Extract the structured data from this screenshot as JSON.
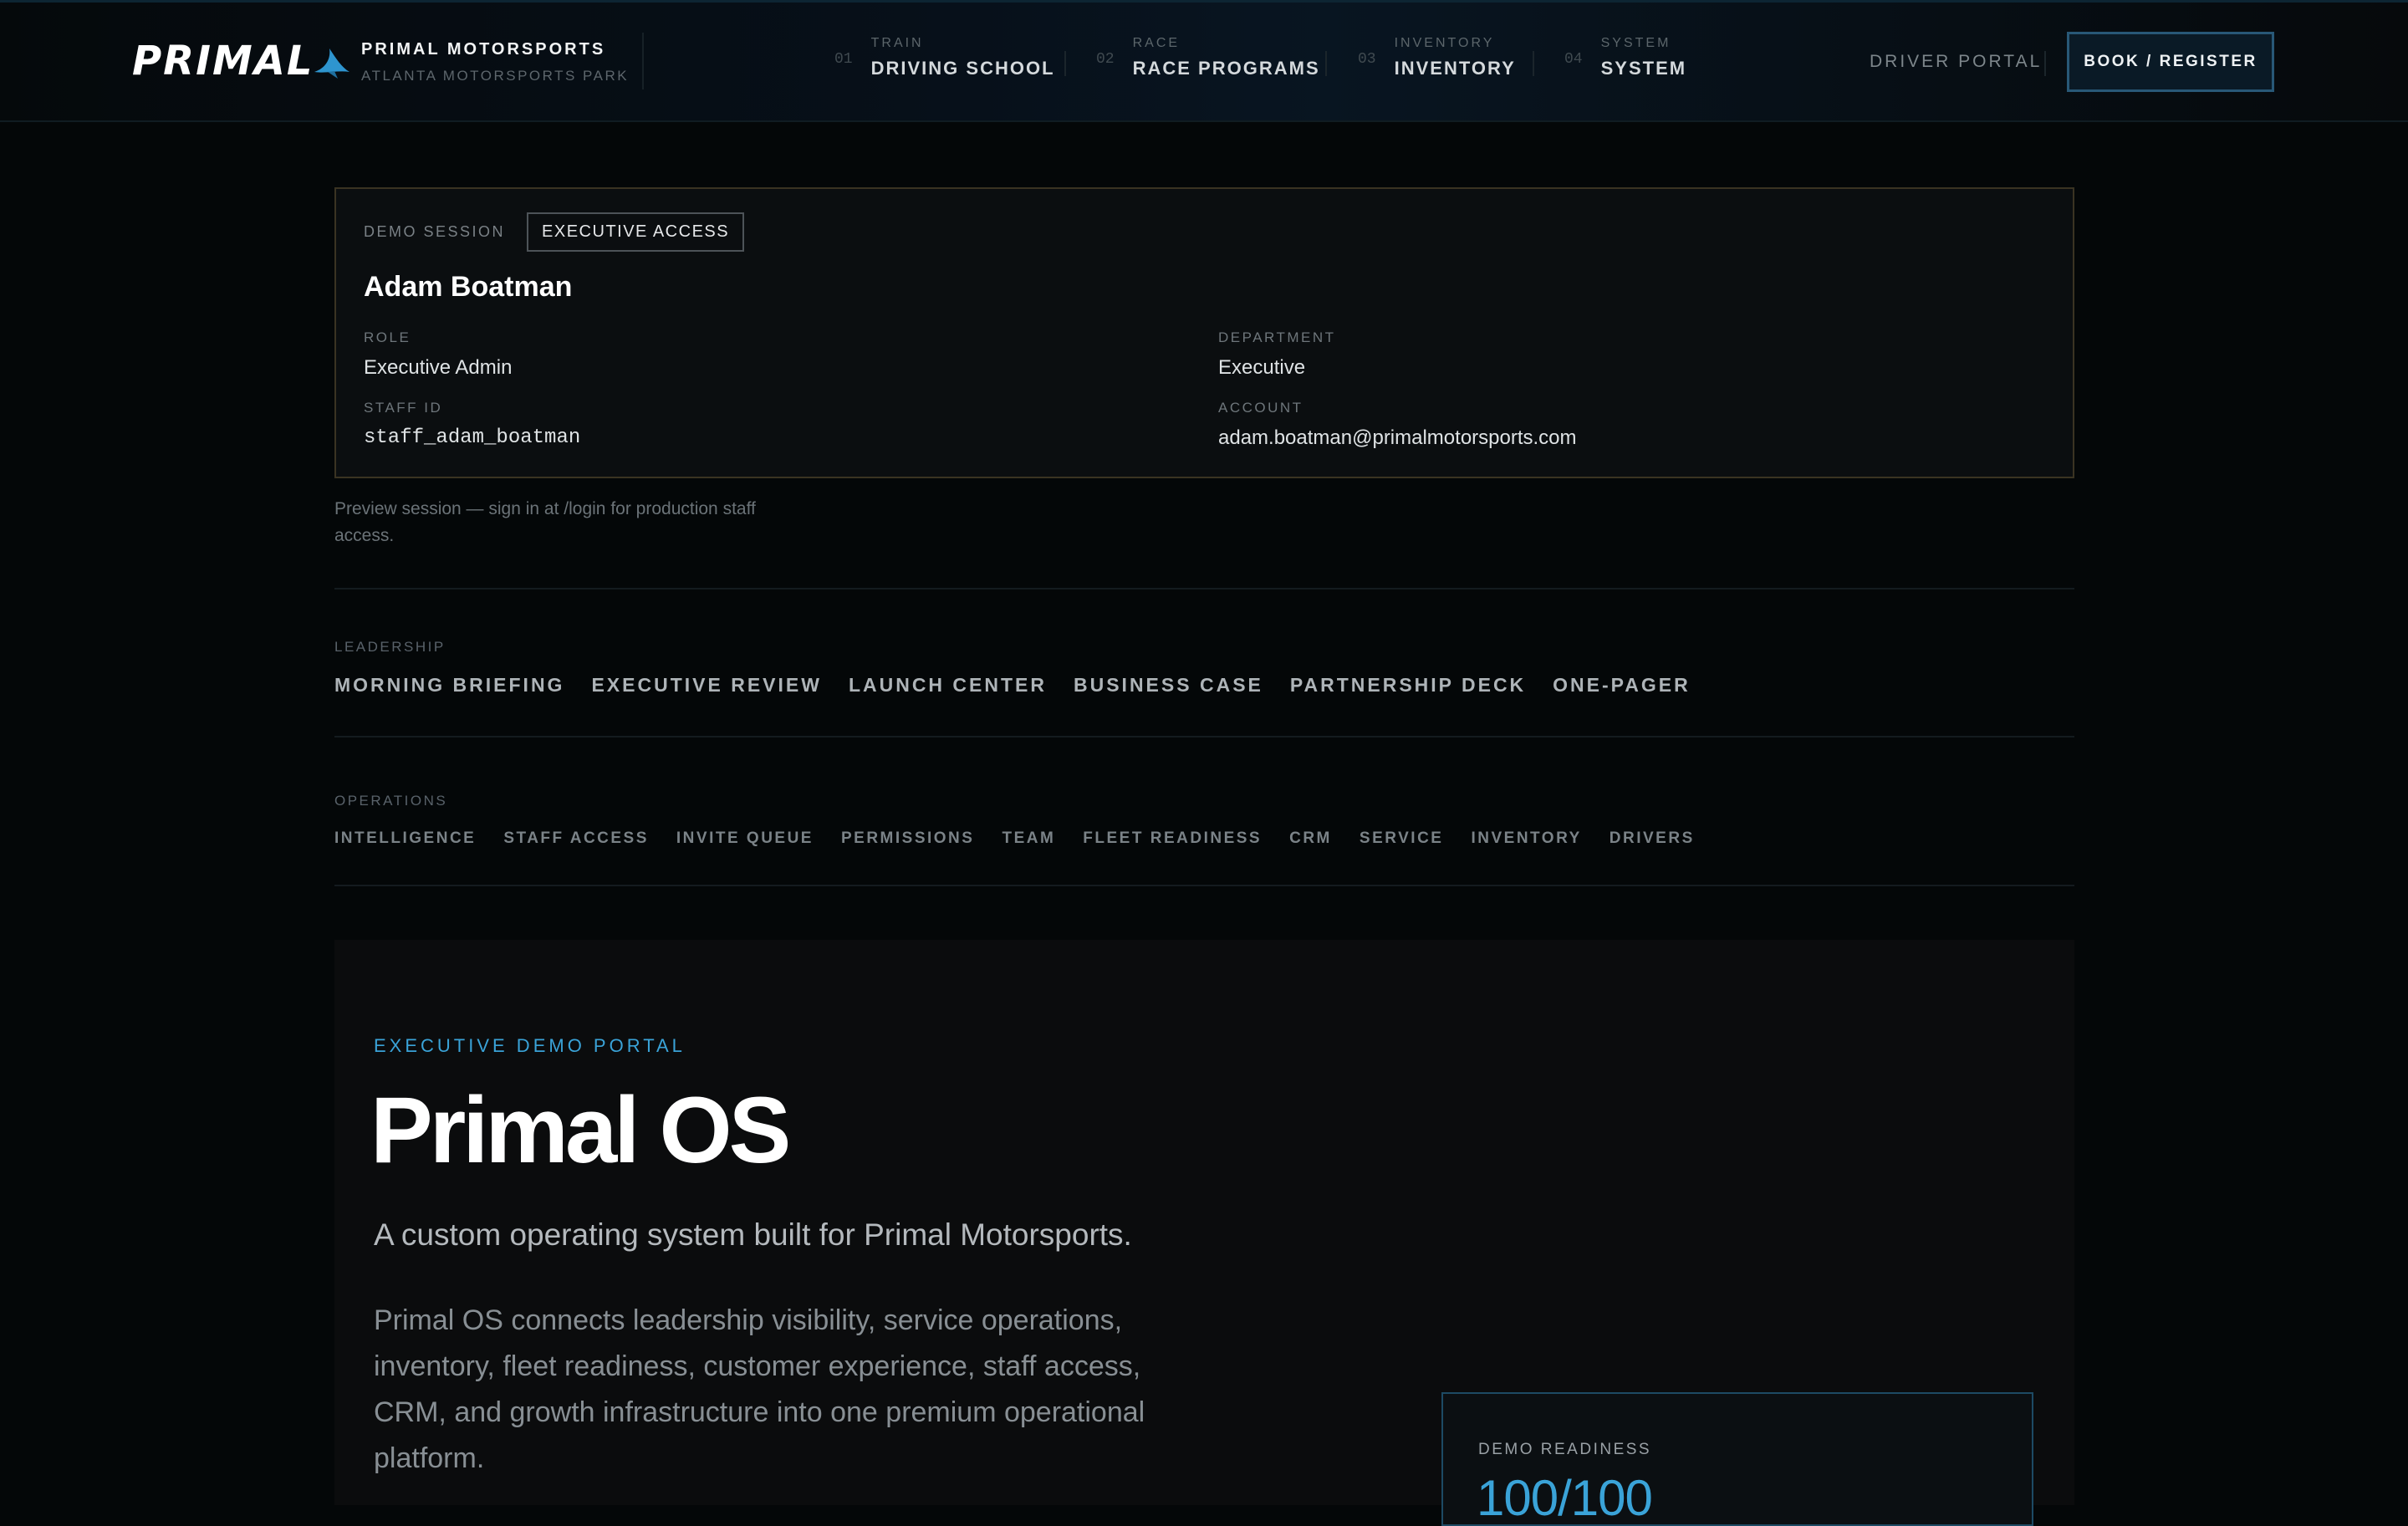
{
  "header": {
    "logo_text": "PRIMAL",
    "brand_name": "PRIMAL MOTORSPORTS",
    "brand_location": "ATLANTA MOTORSPORTS PARK",
    "nav": [
      {
        "num": "01",
        "small": "TRAIN",
        "label": "DRIVING SCHOOL"
      },
      {
        "num": "02",
        "small": "RACE",
        "label": "RACE PROGRAMS"
      },
      {
        "num": "03",
        "small": "INVENTORY",
        "label": "INVENTORY"
      },
      {
        "num": "04",
        "small": "SYSTEM",
        "label": "SYSTEM"
      }
    ],
    "driver_portal": "DRIVER PORTAL",
    "book_button": "BOOK / REGISTER"
  },
  "session": {
    "label": "DEMO SESSION",
    "badge": "EXECUTIVE ACCESS",
    "name": "Adam Boatman",
    "role_label": "ROLE",
    "role": "Executive Admin",
    "department_label": "DEPARTMENT",
    "department": "Executive",
    "staff_id_label": "STAFF ID",
    "staff_id": "staff_adam_boatman",
    "account_label": "ACCOUNT",
    "account": "adam.boatman@primalmotorsports.com",
    "note": "Preview session — sign in at /login for production staff access."
  },
  "leadership": {
    "label": "LEADERSHIP",
    "links": [
      "MORNING BRIEFING",
      "EXECUTIVE REVIEW",
      "LAUNCH CENTER",
      "BUSINESS CASE",
      "PARTNERSHIP DECK",
      "ONE-PAGER"
    ]
  },
  "operations": {
    "label": "OPERATIONS",
    "links": [
      "INTELLIGENCE",
      "STAFF ACCESS",
      "INVITE QUEUE",
      "PERMISSIONS",
      "TEAM",
      "FLEET READINESS",
      "CRM",
      "SERVICE",
      "INVENTORY",
      "DRIVERS"
    ]
  },
  "hero": {
    "eyebrow": "EXECUTIVE DEMO PORTAL",
    "title": "Primal OS",
    "subtitle": "A custom operating system built for Primal Motorsports.",
    "body": "Primal OS connects leadership visibility, service operations, inventory, fleet readiness, customer experience, staff access, CRM, and growth infrastructure into one premium operational platform.",
    "readiness_label": "DEMO READINESS",
    "readiness_value": "100/100"
  },
  "colors": {
    "accent": "#3aa3d8",
    "background": "#040708",
    "card_border": "#3a3322"
  }
}
